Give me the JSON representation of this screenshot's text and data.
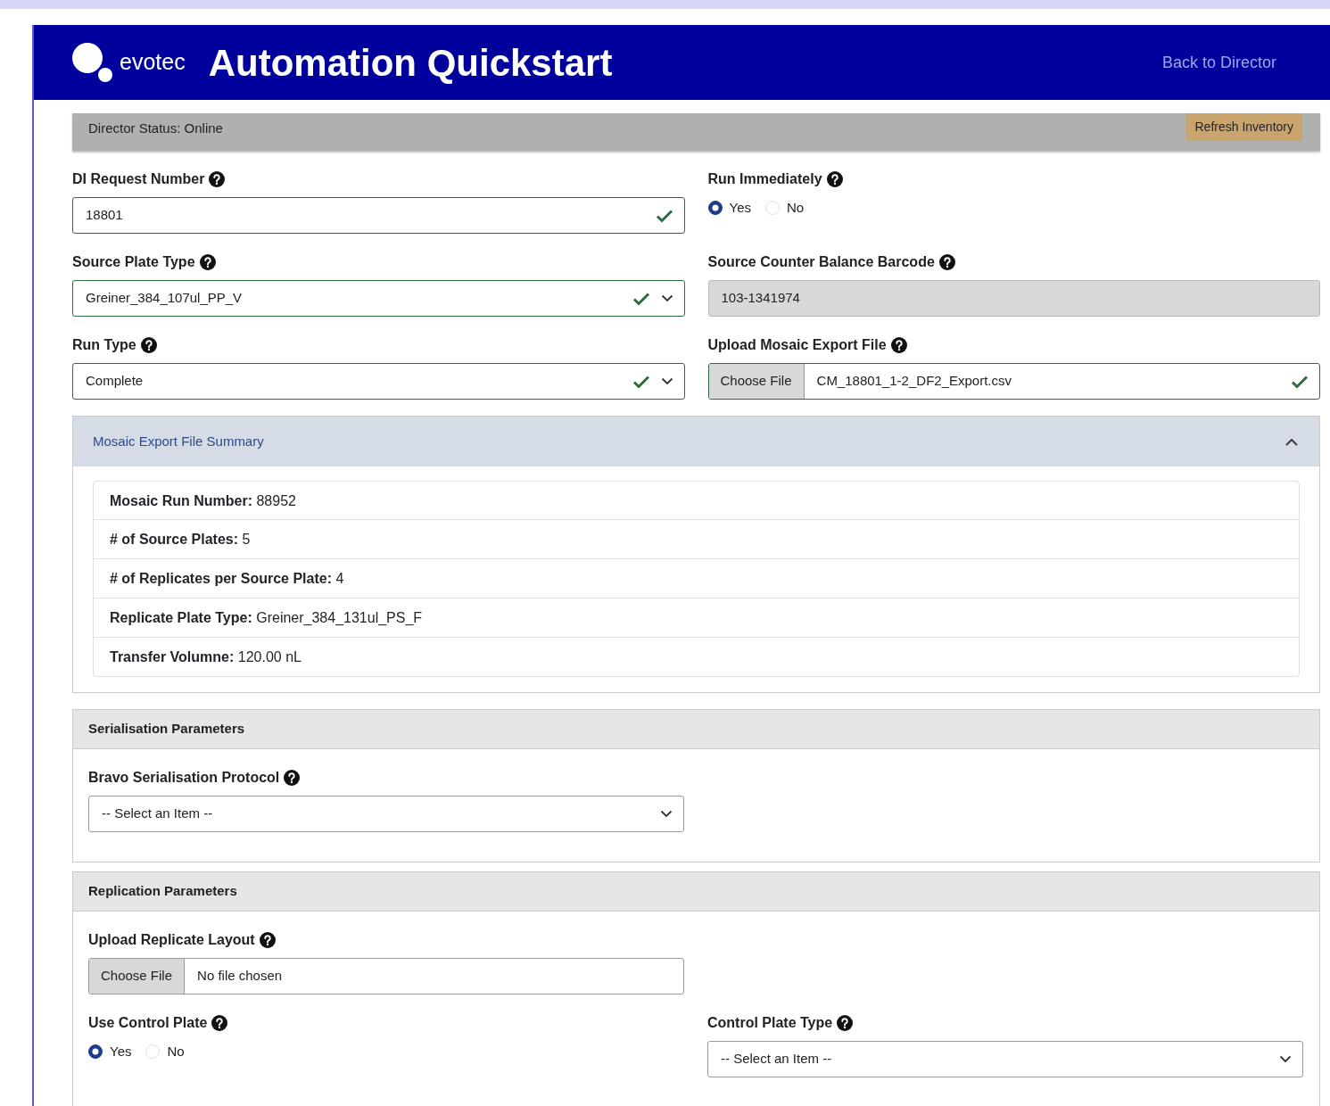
{
  "header": {
    "logo_text": "evotec",
    "title": "Automation Quickstart",
    "back_link": "Back to Director"
  },
  "status_bar": {
    "text": "Director Status: Online",
    "button": "Refresh Inventory"
  },
  "rows": [
    [
      {
        "kind": "text",
        "label": "DI Request Number",
        "value": "18801",
        "valid": true
      },
      {
        "kind": "radio",
        "label": "Run Immediately",
        "options": [
          {
            "label": "Yes",
            "selected": true
          },
          {
            "label": "No",
            "selected": false
          }
        ]
      }
    ],
    [
      {
        "kind": "select",
        "label": "Source Plate Type",
        "value": "Greiner_384_107ul_PP_V",
        "valid": true
      },
      {
        "kind": "readonly",
        "label": "Source Counter Balance Barcode",
        "value": "103-1341974"
      }
    ],
    [
      {
        "kind": "select",
        "label": "Run Type",
        "value": "Complete",
        "valid": true
      },
      {
        "kind": "file",
        "label": "Upload Mosaic Export File",
        "button": "Choose File",
        "value": "CM_18801_1-2_DF2_Export.csv",
        "valid": true
      }
    ]
  ],
  "summary": {
    "title": "Mosaic Export File Summary",
    "expanded": true,
    "items": [
      {
        "text": "**Mosaic Run Number:** 88952"
      },
      {
        "text": "**# of Source Plates:** 5"
      },
      {
        "text": "**# of Replicates per Source Plate:** 4"
      },
      {
        "text": "**Replicate Plate Type:** Greiner_384_131ul_PS_F"
      },
      {
        "text": "**Transfer Volumne:** 120.00 nL"
      }
    ]
  },
  "sections": [
    {
      "title": "Serialisation Parameters",
      "rows": [
        [
          {
            "kind": "select",
            "label": "Bravo Serialisation Protocol",
            "value": "-- Select an Item --",
            "valid": false
          }
        ]
      ]
    },
    {
      "title": "Replication Parameters",
      "rows": [
        [
          {
            "kind": "file",
            "label": "Upload Replicate Layout",
            "button": "Choose File",
            "value": "No file chosen",
            "valid": false
          }
        ],
        [
          {
            "kind": "radio",
            "label": "Use Control Plate",
            "options": [
              {
                "label": "Yes",
                "selected": true
              },
              {
                "label": "No",
                "selected": false
              }
            ]
          },
          {
            "kind": "select",
            "label": "Control Plate Type",
            "value": "-- Select an Item --",
            "valid": false
          }
        ]
      ]
    }
  ]
}
